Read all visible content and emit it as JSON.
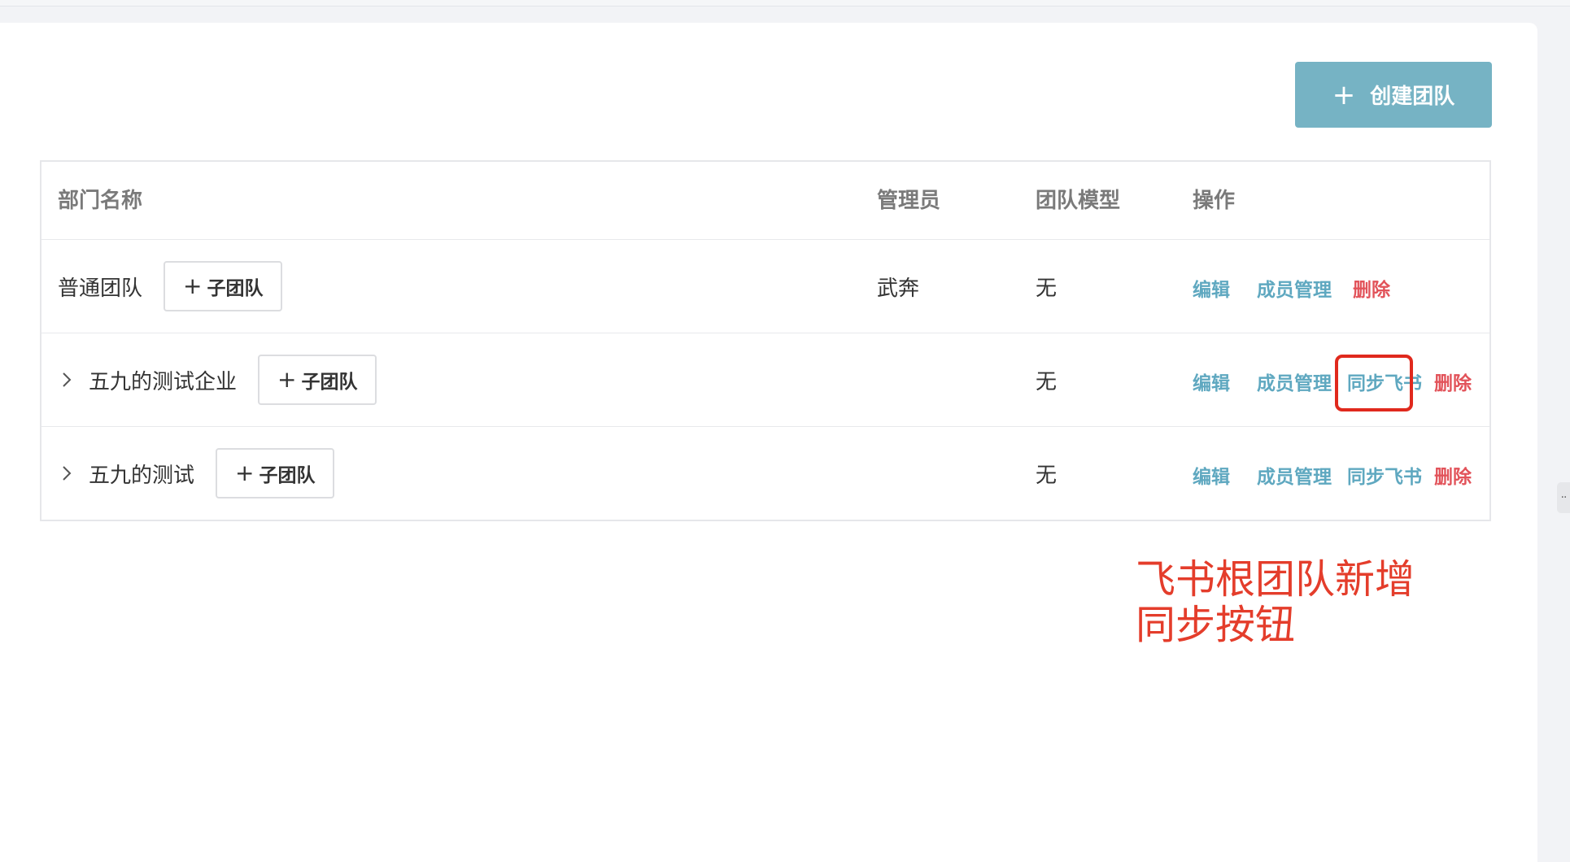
{
  "create_button": {
    "label": "创建团队",
    "icon": "plus-icon"
  },
  "table": {
    "headers": {
      "name": "部门名称",
      "admin": "管理员",
      "model": "团队模型",
      "ops": "操作"
    },
    "rows": [
      {
        "name": "普通团队",
        "expandable": false,
        "sub_team_label": "子团队",
        "admin": "武奔",
        "model": "无",
        "actions": {
          "edit": "编辑",
          "members": "成员管理",
          "delete": "删除"
        }
      },
      {
        "name": "五九的测试企业",
        "expandable": true,
        "sub_team_label": "子团队",
        "admin": "",
        "model": "无",
        "actions": {
          "edit": "编辑",
          "members": "成员管理",
          "sync": "同步飞书",
          "delete": "删除"
        }
      },
      {
        "name": "五九的测试",
        "expandable": true,
        "sub_team_label": "子团队",
        "admin": "",
        "model": "无",
        "actions": {
          "edit": "编辑",
          "members": "成员管理",
          "sync": "同步飞书",
          "delete": "删除"
        }
      }
    ]
  },
  "annotation": {
    "line1": "飞书根团队新增",
    "line2": "同步按钮"
  },
  "colors": {
    "primary_button": "#76b3c4",
    "link_blue": "#5fa8c0",
    "link_red": "#e2535a",
    "annotation_red": "#e43d2b"
  }
}
